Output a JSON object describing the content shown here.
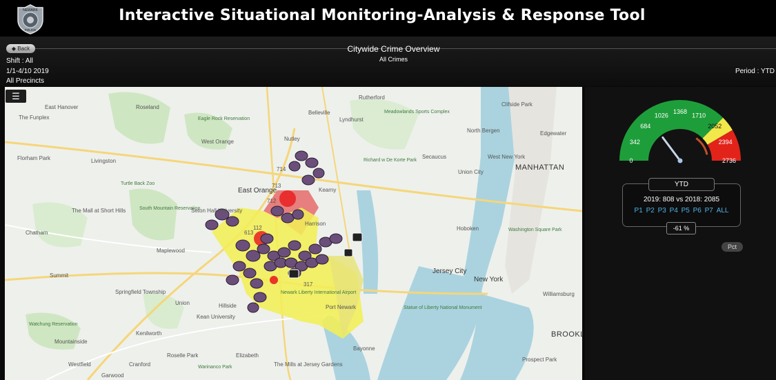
{
  "header": {
    "title": "Interactive Situational Monitoring-Analysis & Response Tool",
    "badge_text": [
      "NEWARK",
      "POLICE"
    ]
  },
  "toolbar": {
    "back_label": "◆ Back"
  },
  "view": {
    "title": "Citywide Crime Overview",
    "subtitle": "All Crimes"
  },
  "filters": {
    "shift": "Shift : All",
    "date_range": "1/1-4/10 2019",
    "precincts": "All Precincts",
    "period": "Period : YTD"
  },
  "map": {
    "menu_icon": "hamburger-icon",
    "labels": [
      "East Hanover",
      "Roseland",
      "Rutherford",
      "Clifside Park",
      "The Funplex",
      "Eagle Rock Reservation",
      "Lyndhurst",
      "Meadowlands Sports Complex",
      "North Bergen",
      "Edgewater",
      "West Orange",
      "Nutley",
      "Belleville",
      "Secaucus",
      "West New York",
      "Florham Park",
      "Livingston",
      "Richard w De Korte Park",
      "Union City",
      "Turtle Back Zoo",
      "East Orange",
      "Kearny",
      "Harrison",
      "South Mountain Reservation",
      "Seton Hall University",
      "The Mall at Short Hills",
      "Chatham",
      "Maplewood",
      "Hoboken",
      "Washington Square Park",
      "Summit",
      "Jersey City",
      "Springfield Township",
      "Union",
      "Hillside",
      "Kean University",
      "Newark Liberty International Airport",
      "Statue of Liberty National Monument",
      "Port Newark",
      "Watchung Reservation",
      "Mountainside",
      "Kenilworth",
      "Bayonne",
      "Westfield",
      "Cranford",
      "Roselle Park",
      "Elizabeth",
      "Garwood",
      "Warinanco Park",
      "The Mills at Jersey Gardens",
      "Prospect Park",
      "MANHATTAN",
      "New York",
      "BROOKLYN",
      "Williamsburg"
    ],
    "precinct_counts": [
      "714",
      "713",
      "712",
      "112",
      "613",
      "317"
    ]
  },
  "gauge": {
    "ticks": [
      "0",
      "342",
      "684",
      "1026",
      "1368",
      "1710",
      "2052",
      "2394",
      "2736"
    ],
    "value": 808,
    "max": 2736,
    "colors": {
      "green": "#1e9e3a",
      "yellow": "#f2e84a",
      "red": "#e2231a"
    }
  },
  "summary": {
    "period_label": "YTD",
    "comparison": "2019: 808 vs 2018: 2085",
    "precinct_links": [
      "P1",
      "P2",
      "P3",
      "P4",
      "P5",
      "P6",
      "P7",
      "ALL"
    ],
    "pct_change": "-61 %",
    "pct_button": "Pct"
  }
}
